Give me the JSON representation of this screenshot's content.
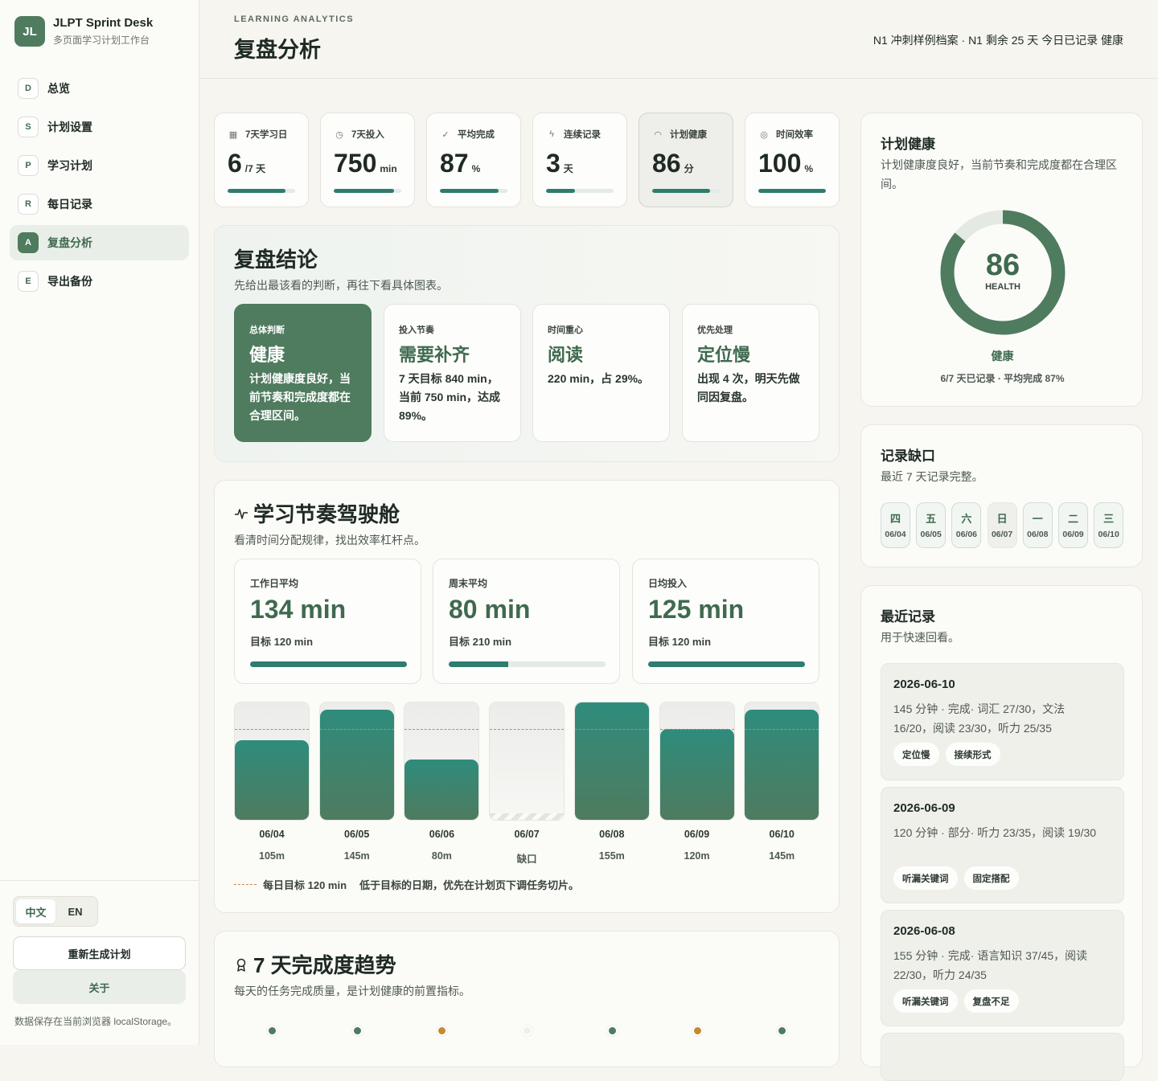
{
  "brand": {
    "logo": "JL",
    "name": "JLPT Sprint Desk",
    "subtitle": "多页面学习计划工作台"
  },
  "nav": [
    {
      "key": "D",
      "label": "总览"
    },
    {
      "key": "S",
      "label": "计划设置"
    },
    {
      "key": "P",
      "label": "学习计划"
    },
    {
      "key": "R",
      "label": "每日记录"
    },
    {
      "key": "A",
      "label": "复盘分析",
      "active": true
    },
    {
      "key": "E",
      "label": "导出备份"
    }
  ],
  "language": {
    "zh": "中文",
    "en": "EN",
    "selected": "zh"
  },
  "actions": {
    "regenerate": "重新生成计划",
    "about": "关于"
  },
  "storage_note": "数据保存在当前浏览器 localStorage。",
  "header": {
    "eyebrow": "LEARNING ANALYTICS",
    "title": "复盘分析",
    "status": "N1 冲刺样例档案 · N1  剩余 25 天  今日已记录  健康"
  },
  "metrics": [
    {
      "icon": "calendar-icon",
      "glyph": "▦",
      "label": "7天学习日",
      "value": "6",
      "unit": "/7 天",
      "progress": 0.86
    },
    {
      "icon": "clock-icon",
      "glyph": "◷",
      "label": "7天投入",
      "value": "750",
      "unit": "min",
      "progress": 0.89
    },
    {
      "icon": "check-circle-icon",
      "glyph": "✓",
      "label": "平均完成",
      "value": "87",
      "unit": "%",
      "progress": 0.87
    },
    {
      "icon": "bolt-icon",
      "glyph": "ϟ",
      "label": "连续记录",
      "value": "3",
      "unit": "天",
      "progress": 0.43
    },
    {
      "icon": "gauge-icon",
      "glyph": "◠",
      "label": "计划健康",
      "value": "86",
      "unit": "分",
      "progress": 0.86,
      "selected": true
    },
    {
      "icon": "target-icon",
      "glyph": "◎",
      "label": "时间效率",
      "value": "100",
      "unit": "%",
      "progress": 1.0
    }
  ],
  "conclusion": {
    "title": "复盘结论",
    "subtitle": "先给出最该看的判断，再往下看具体图表。",
    "cards": [
      {
        "tag": "总体判断",
        "head": "健康",
        "body": "计划健康度良好，当前节奏和完成度都在合理区间。",
        "primary": true
      },
      {
        "tag": "投入节奏",
        "head": "需要补齐",
        "body": "7 天目标 840 min，当前 750 min，达成 89%。"
      },
      {
        "tag": "时间重心",
        "head": "阅读",
        "body": "220 min，占 29%。"
      },
      {
        "tag": "优先处理",
        "head": "定位慢",
        "body": "出现 4 次，明天先做同因复盘。"
      }
    ]
  },
  "rhythm": {
    "title": "学习节奏驾驶舱",
    "subtitle": "看清时间分配规律，找出效率杠杆点。",
    "stats": [
      {
        "label": "工作日平均",
        "value": "134 min",
        "target": "目标 120 min",
        "progress": 1.0
      },
      {
        "label": "周末平均",
        "value": "80 min",
        "target": "目标 210 min",
        "progress": 0.38
      },
      {
        "label": "日均投入",
        "value": "125 min",
        "target": "目标 120 min",
        "progress": 1.0
      }
    ],
    "legend_target": "每日目标 120 min",
    "legend_note": "低于目标的日期，优先在计划页下调任务切片。"
  },
  "chart_data": {
    "type": "bar",
    "categories": [
      "06/04",
      "06/05",
      "06/06",
      "06/07",
      "06/08",
      "06/09",
      "06/10"
    ],
    "values": [
      105,
      145,
      80,
      0,
      155,
      120,
      145
    ],
    "value_labels": [
      "105m",
      "145m",
      "80m",
      "缺口",
      "155m",
      "120m",
      "145m"
    ],
    "missing": [
      false,
      false,
      false,
      true,
      false,
      false,
      false
    ],
    "target": 120,
    "ylim": [
      0,
      155
    ]
  },
  "trend": {
    "title": "7 天完成度趋势",
    "subtitle": "每天的任务完成质量，是计划健康的前置指标。",
    "dots": [
      "#4f7b5f",
      "#4f7b5f",
      "#c58a2e",
      "#eef0ed",
      "#4f7b5f",
      "#c58a2e",
      "#4f7b5f"
    ]
  },
  "health": {
    "title": "计划健康",
    "subtitle": "计划健康度良好，当前节奏和完成度都在合理区间。",
    "score": "86",
    "score_label": "HEALTH",
    "score_fraction": 0.86,
    "status": "健康",
    "meta": "6/7 天已记录 · 平均完成 87%"
  },
  "gaps": {
    "title": "记录缺口",
    "subtitle": "最近 7 天记录完整。",
    "days": [
      {
        "weekday": "四",
        "date": "06/04"
      },
      {
        "weekday": "五",
        "date": "06/05"
      },
      {
        "weekday": "六",
        "date": "06/06"
      },
      {
        "weekday": "日",
        "date": "06/07",
        "missing": true
      },
      {
        "weekday": "一",
        "date": "06/08"
      },
      {
        "weekday": "二",
        "date": "06/09"
      },
      {
        "weekday": "三",
        "date": "06/10"
      }
    ]
  },
  "recent": {
    "title": "最近记录",
    "subtitle": "用于快速回看。",
    "items": [
      {
        "date": "2026-06-10",
        "text": "145 分钟 · 完成· 词汇 27/30，文法 16/20，阅读 23/30，听力 25/35",
        "tags": [
          "定位慢",
          "接续形式"
        ]
      },
      {
        "date": "2026-06-09",
        "text": "120 分钟 · 部分· 听力 23/35，阅读 19/30",
        "tags": [
          "听漏关键词",
          "固定搭配"
        ]
      },
      {
        "date": "2026-06-08",
        "text": "155 分钟 · 完成· 语言知识 37/45，阅读 22/30，听力 24/35",
        "tags": [
          "听漏关键词",
          "复盘不足"
        ]
      }
    ]
  }
}
